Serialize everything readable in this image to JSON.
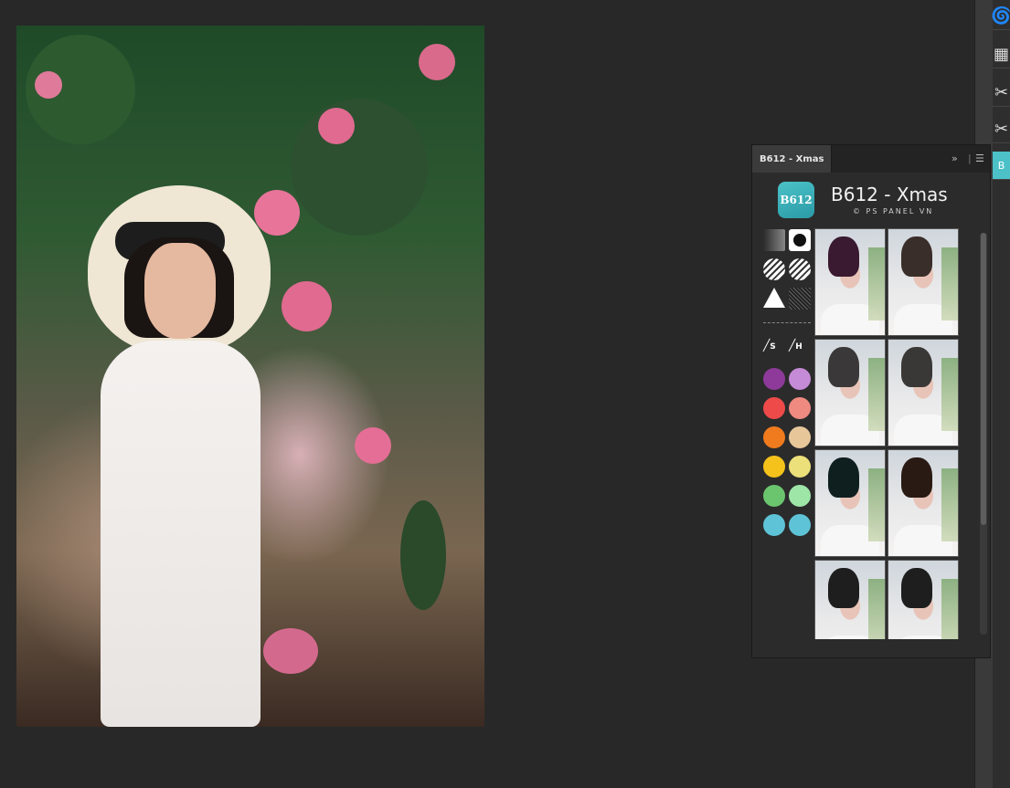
{
  "panel": {
    "tab_label": "B612 - Xmas",
    "expand_icon": "double-chevron-right-icon",
    "menu_icon": "hamburger-menu-icon",
    "title": "B612 - Xmas",
    "subtitle": "© PS PANEL VN",
    "logo_text": "B612",
    "tools": [
      {
        "name": "gradient-tool",
        "shape": "square",
        "colors": [
          "#2b2b2b",
          "#888888"
        ]
      },
      {
        "name": "circle-black-tool",
        "shape": "circle",
        "color": "#111111"
      },
      {
        "name": "stripe-half-left-tool",
        "shape": "circle",
        "color": "#ffffff"
      },
      {
        "name": "stripe-half-right-tool",
        "shape": "circle",
        "color": "#ffffff"
      },
      {
        "name": "triangle-tool",
        "shape": "triangle",
        "color": "#ffffff"
      },
      {
        "name": "noise-tool",
        "shape": "square",
        "color": "#222222"
      },
      {
        "name": "brush-s-tool",
        "label": "S"
      },
      {
        "name": "brush-h-tool",
        "label": "H"
      }
    ],
    "swatches": [
      [
        "#8e3a9a",
        "#c68bd7"
      ],
      [
        "#ee4a4a",
        "#ee8a80"
      ],
      [
        "#f07a1e",
        "#e7c79a"
      ],
      [
        "#f4c21a",
        "#ece07a"
      ],
      [
        "#6bc56e",
        "#9ee6a8"
      ],
      [
        "#5ec3d6",
        "#5ec3d6"
      ]
    ],
    "thumbnails": [
      {
        "hair": "#3a1a30"
      },
      {
        "hair": "#3a2e2a"
      },
      {
        "hair": "#3a3838"
      },
      {
        "hair": "#3a3836"
      },
      {
        "hair": "#0f1f20"
      },
      {
        "hair": "#2a1a14"
      },
      {
        "hair": "#1e1e1e"
      },
      {
        "hair": "#1e1e1e"
      }
    ]
  },
  "side_icons": [
    "spiral-icon",
    "layer-swatch-icon",
    "scissors-icon",
    "scissors-icon",
    "b612-panel-icon"
  ]
}
